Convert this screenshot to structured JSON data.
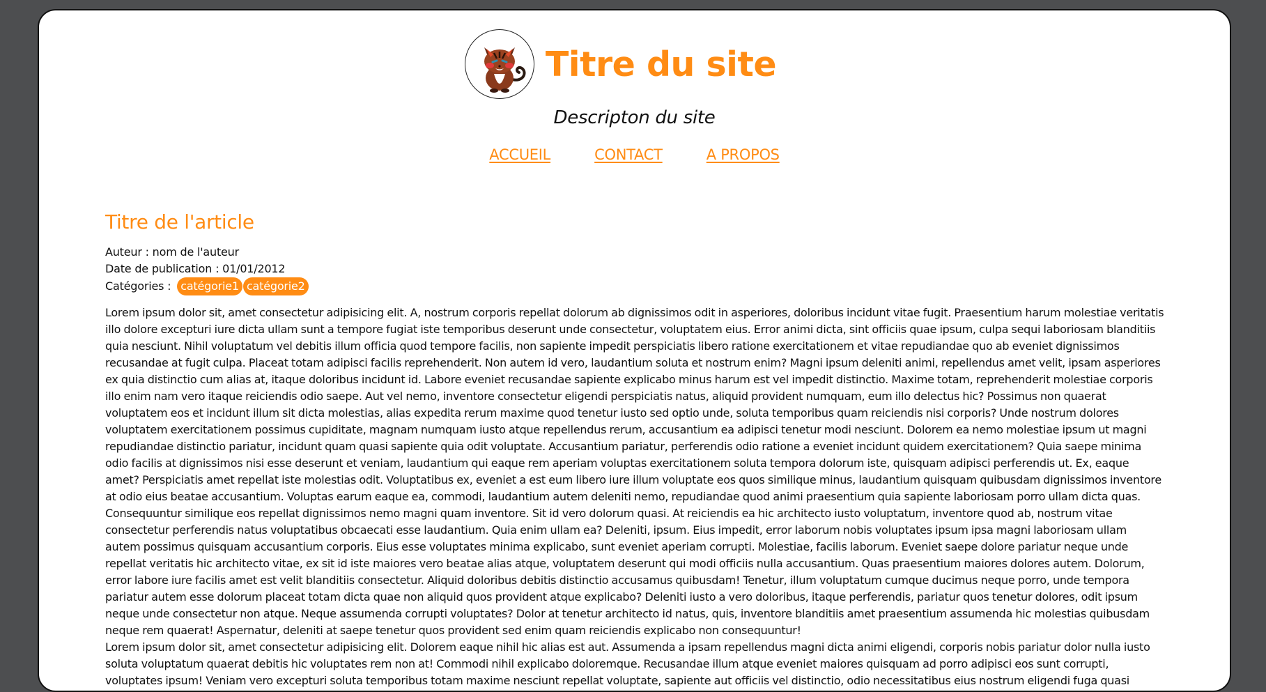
{
  "site": {
    "title": "Titre du site",
    "description": "Descripton du site",
    "logo_icon": "cat-mascot-icon",
    "accent_color": "#ff8c14",
    "background_color": "#4d4e50"
  },
  "nav": {
    "items": [
      {
        "label": "ACCUEIL"
      },
      {
        "label": "CONTACT"
      },
      {
        "label": "A PROPOS"
      }
    ]
  },
  "article": {
    "title": "Titre de l'article",
    "author_line": "Auteur : nom de l'auteur",
    "date_line": "Date de publication : 01/01/2012",
    "categories_label": "Catégories :",
    "categories": [
      "catégorie1",
      "catégorie2"
    ],
    "paragraphs": [
      "Lorem ipsum dolor sit, amet consectetur adipisicing elit. A, nostrum corporis repellat dolorum ab dignissimos odit in asperiores, doloribus incidunt vitae fugit. Praesentium harum molestiae veritatis illo dolore excepturi iure dicta ullam sunt a tempore fugiat iste temporibus deserunt unde consectetur, voluptatem eius. Error animi dicta, sint officiis quae ipsum, culpa sequi laboriosam blanditiis quia nesciunt. Nihil voluptatum vel debitis illum officia quod tempore facilis, non sapiente impedit perspiciatis libero ratione exercitationem et vitae repudiandae quo ab eveniet dignissimos recusandae at fugit culpa. Placeat totam adipisci facilis reprehenderit. Non autem id vero, laudantium soluta et nostrum enim? Magni ipsum deleniti animi, repellendus amet velit, ipsam asperiores ex quia distinctio cum alias at, itaque doloribus incidunt id. Labore eveniet recusandae sapiente explicabo minus harum est vel impedit distinctio. Maxime totam, reprehenderit molestiae corporis illo enim nam vero itaque reiciendis odio saepe. Aut vel nemo, inventore consectetur eligendi perspiciatis natus, aliquid provident numquam, eum illo delectus hic? Possimus non quaerat voluptatem eos et incidunt illum sit dicta molestias, alias expedita rerum maxime quod tenetur iusto sed optio unde, soluta temporibus quam reiciendis nisi corporis? Unde nostrum dolores voluptatem exercitationem possimus cupiditate, magnam numquam iusto atque repellendus rerum, accusantium ea adipisci tenetur modi nesciunt. Dolorem ea nemo molestiae ipsum ut magni repudiandae distinctio pariatur, incidunt quam quasi sapiente quia odit voluptate. Accusantium pariatur, perferendis odio ratione a eveniet incidunt quidem exercitationem? Quia saepe minima odio facilis at dignissimos nisi esse deserunt et veniam, laudantium qui eaque rem aperiam voluptas exercitationem soluta tempora dolorum iste, quisquam adipisci perferendis ut. Ex, eaque amet? Perspiciatis amet repellat iste molestias odit. Voluptatibus ex, eveniet a est eum libero iure illum voluptate eos quos similique minus, laudantium quisquam quibusdam dignissimos inventore at odio eius beatae accusantium. Voluptas earum eaque ea, commodi, laudantium autem deleniti nemo, repudiandae quod animi praesentium quia sapiente laboriosam porro ullam dicta quas. Consequuntur similique eos repellat dignissimos nemo magni quam inventore. Sit id vero dolorum quasi. At reiciendis ea hic architecto iusto voluptatum, inventore quod ab, nostrum vitae consectetur perferendis natus voluptatibus obcaecati esse laudantium. Quia enim ullam ea? Deleniti, ipsum. Eius impedit, error laborum nobis voluptates ipsum ipsa magni laboriosam ullam autem possimus quisquam accusantium corporis. Eius esse voluptates minima explicabo, sunt eveniet aperiam corrupti. Molestiae, facilis laborum. Eveniet saepe dolore pariatur neque unde repellat veritatis hic architecto vitae, ex sit id iste maiores vero beatae alias atque, voluptatem deserunt qui modi officiis nulla accusantium. Quas praesentium maiores dolores autem. Dolorum, error labore iure facilis amet est velit blanditiis consectetur. Aliquid doloribus debitis distinctio accusamus quibusdam! Tenetur, illum voluptatum cumque ducimus neque porro, unde tempora pariatur autem esse dolorum placeat totam dicta quae non aliquid quos provident atque explicabo? Deleniti iusto a vero doloribus, itaque perferendis, pariatur quos tenetur dolores, odit ipsum neque unde consectetur non atque. Neque assumenda corrupti voluptates? Dolor at tenetur architecto id natus, quis, inventore blanditiis amet praesentium assumenda hic molestias quibusdam neque rem quaerat! Aspernatur, deleniti at saepe tenetur quos provident sed enim quam reiciendis explicabo non consequuntur!",
      "Lorem ipsum dolor sit, amet consectetur adipisicing elit. Dolorem eaque nihil hic alias est aut. Assumenda a ipsam repellendus magni dicta animi eligendi, corporis nobis pariatur dolor nulla iusto soluta voluptatum quaerat debitis hic voluptates rem non at! Commodi nihil explicabo doloremque. Recusandae illum atque eveniet maiores quisquam ad porro adipisci eos sunt corrupti, voluptates ipsum! Veniam vero excepturi soluta temporibus totam maxime nesciunt repellat voluptate, sapiente aut officiis vel distinctio, odio necessitatibus eius nostrum eligendi fuga quasi delectus cumque facere"
    ]
  }
}
